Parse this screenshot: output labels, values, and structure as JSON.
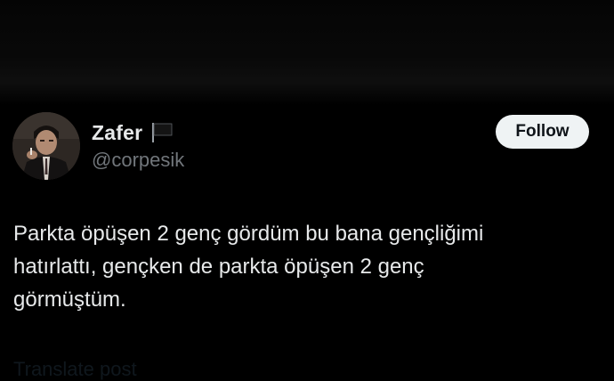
{
  "tweet": {
    "author": {
      "display_name": "Zafer",
      "handle": "@corpesik",
      "badge_icon": "black-flag-icon"
    },
    "follow_label": "Follow",
    "text_lines": [
      "Parkta öpüşen 2 genç gördüm bu bana gençliğimi",
      "hatırlattı, gençken de parkta öpüşen 2 genç",
      "görmüştüm."
    ],
    "translate_label": "Translate post"
  },
  "colors": {
    "background": "#000000",
    "primary_text": "#e7e9ea",
    "secondary_text": "#71767b",
    "follow_button_bg": "#eff3f4",
    "follow_button_text": "#0f1419"
  }
}
